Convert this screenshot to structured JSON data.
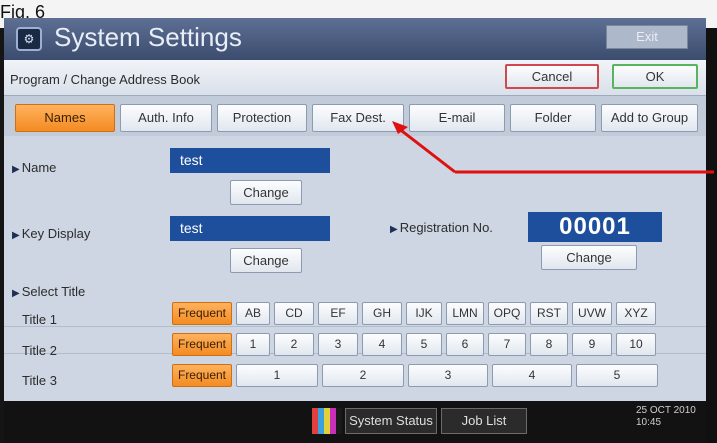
{
  "caption": "Fig. 6",
  "titlebar": {
    "title": "System Settings",
    "exit_label": "Exit",
    "icon": "settings-icon"
  },
  "header": {
    "breadcrumb": "Program / Change Address Book",
    "cancel": "Cancel",
    "ok": "OK"
  },
  "tabs": [
    "Names",
    "Auth. Info",
    "Protection",
    "Fax Dest.",
    "E-mail",
    "Folder",
    "Add to Group"
  ],
  "name": {
    "label": "Name",
    "value": "test",
    "change": "Change"
  },
  "key_display": {
    "label": "Key Display",
    "value": "test",
    "change": "Change"
  },
  "registration": {
    "label": "Registration No.",
    "value": "00001",
    "change": "Change"
  },
  "select_title": {
    "label": "Select Title",
    "title1": {
      "label": "Title 1",
      "freq": "Frequent",
      "keys": [
        "AB",
        "CD",
        "EF",
        "GH",
        "IJK",
        "LMN",
        "OPQ",
        "RST",
        "UVW",
        "XYZ"
      ]
    },
    "title2": {
      "label": "Title 2",
      "freq": "Frequent",
      "keys": [
        "1",
        "2",
        "3",
        "4",
        "5",
        "6",
        "7",
        "8",
        "9",
        "10"
      ]
    },
    "title3": {
      "label": "Title 3",
      "freq": "Frequent",
      "keys": [
        "1",
        "2",
        "3",
        "4",
        "5"
      ]
    }
  },
  "footer": {
    "system_status": "System Status",
    "job_list": "Job List",
    "date": "25 OCT  2010",
    "time": "10:45"
  },
  "colors": {
    "accent_orange": "#f38b22",
    "field_blue": "#1e4f9c",
    "annotation_red": "#e01010"
  }
}
